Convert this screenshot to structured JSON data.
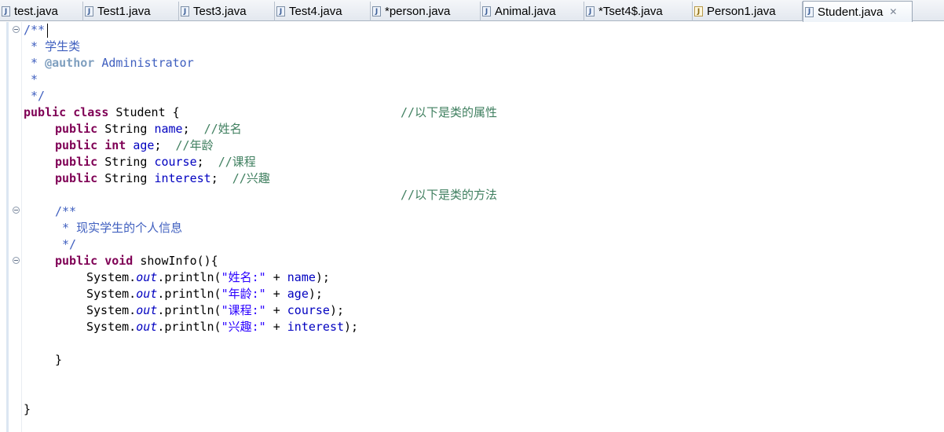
{
  "tabs": [
    {
      "label": "test.java",
      "icon": "java-file-icon"
    },
    {
      "label": "Test1.java",
      "icon": "java-file-icon"
    },
    {
      "label": "Test3.java",
      "icon": "java-file-icon"
    },
    {
      "label": "Test4.java",
      "icon": "java-file-icon"
    },
    {
      "label": "*person.java",
      "icon": "java-file-icon"
    },
    {
      "label": "Animal.java",
      "icon": "java-file-icon"
    },
    {
      "label": "*Tset4$.java",
      "icon": "java-file-icon"
    },
    {
      "label": "Person1.java",
      "icon": "java-file-warning-icon"
    },
    {
      "label": "Student.java",
      "icon": "java-file-icon",
      "active": true,
      "close": "✕"
    }
  ],
  "colors": {
    "keyword": "#7f0055",
    "field": "#0000c0",
    "string": "#2a00ff",
    "comment": "#3f7f5f",
    "javadoc": "#3f5fbf",
    "javadoc_tag": "#7f9fbf"
  },
  "code": {
    "l1": "/**",
    "l2": " * 学生类",
    "l3_pre": " * ",
    "l3_tag": "@author",
    "l3_post": " Administrator",
    "l4": " *",
    "l5": " */",
    "class_kw1": "public",
    "class_kw2": "class",
    "class_name": " Student {",
    "class_comment": "//以下是类的属性",
    "f1_type": " String ",
    "f1_name": "name",
    "f1_end": ";  ",
    "f1_comment": "//姓名",
    "f2_type": "int",
    "f2_name": "age",
    "f2_end": ";  ",
    "f2_comment": "//年龄",
    "f3_type": " String ",
    "f3_name": "course",
    "f3_end": ";  ",
    "f3_comment": "//课程",
    "f4_type": " String ",
    "f4_name": "interest",
    "f4_end": ";  ",
    "f4_comment": "//兴趣",
    "methods_comment": "//以下是类的方法",
    "doc_open": "/**",
    "doc_text": " * 现实学生的个人信息",
    "doc_close": " */",
    "method_kw1": "public",
    "method_kw2": "void",
    "method_sig": " showInfo(){",
    "sys": "System.",
    "out": "out",
    "println": ".println(",
    "p1_str": "\"姓名:\"",
    "p2_str": "\"年龄:\"",
    "p3_str": "\"课程:\"",
    "p4_str": "\"兴趣:\"",
    "plus": " + ",
    "p1_var": "name",
    "p2_var": "age",
    "p3_var": "course",
    "p4_var": "interest",
    "close_paren": ");",
    "method_close": "}",
    "class_close": "}",
    "kw_public": "public",
    "kw_space": " "
  }
}
